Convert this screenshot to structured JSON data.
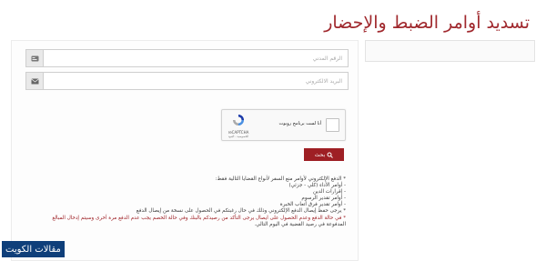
{
  "page": {
    "title": "تسديد أوامر الضبط والإحضار"
  },
  "form": {
    "civil_id_placeholder": "الرقم المدني",
    "email_placeholder": "البريد الالكتروني",
    "search_label": "بحث"
  },
  "captcha": {
    "label": "أنا لست برنامج روبوت",
    "brand": "reCAPTCHA",
    "links": "الخصوصية - البنود"
  },
  "notes": [
    "* الدفع الإلكتروني لأوامر منع السفر لأنواع القضايا التالية فقط:",
    "- أوامر الأداء (كلي - جزئي)",
    "- إقرارات الدين",
    "- أوامر تقدير الرسوم",
    "- أوامر تقدير فرق أتعاب الخبرة",
    "* يرجى حفظ إيصال الدفع الإلكتروني وذلك في حال رغبتكم في الحصول على نسخة من إيصال الدفع",
    "* في حالة الدفع وعدم الحصول على ايصال يرجى التأكد من رصيدكم بالبنك وفي حالة الخصم يجب عدم الدفع مرة أخرى وسيتم إدخال المبالغ",
    "المدفوعة في رصيد القضية في اليوم التالي."
  ],
  "watermark": "مقالات الكويت",
  "colors": {
    "accent": "#9e1f24",
    "watermark_bg": "#0f3f7a"
  },
  "icons": {
    "civil_id": "id-card-icon",
    "email": "envelope-icon",
    "search": "search-icon",
    "captcha": "recaptcha-logo-icon"
  }
}
